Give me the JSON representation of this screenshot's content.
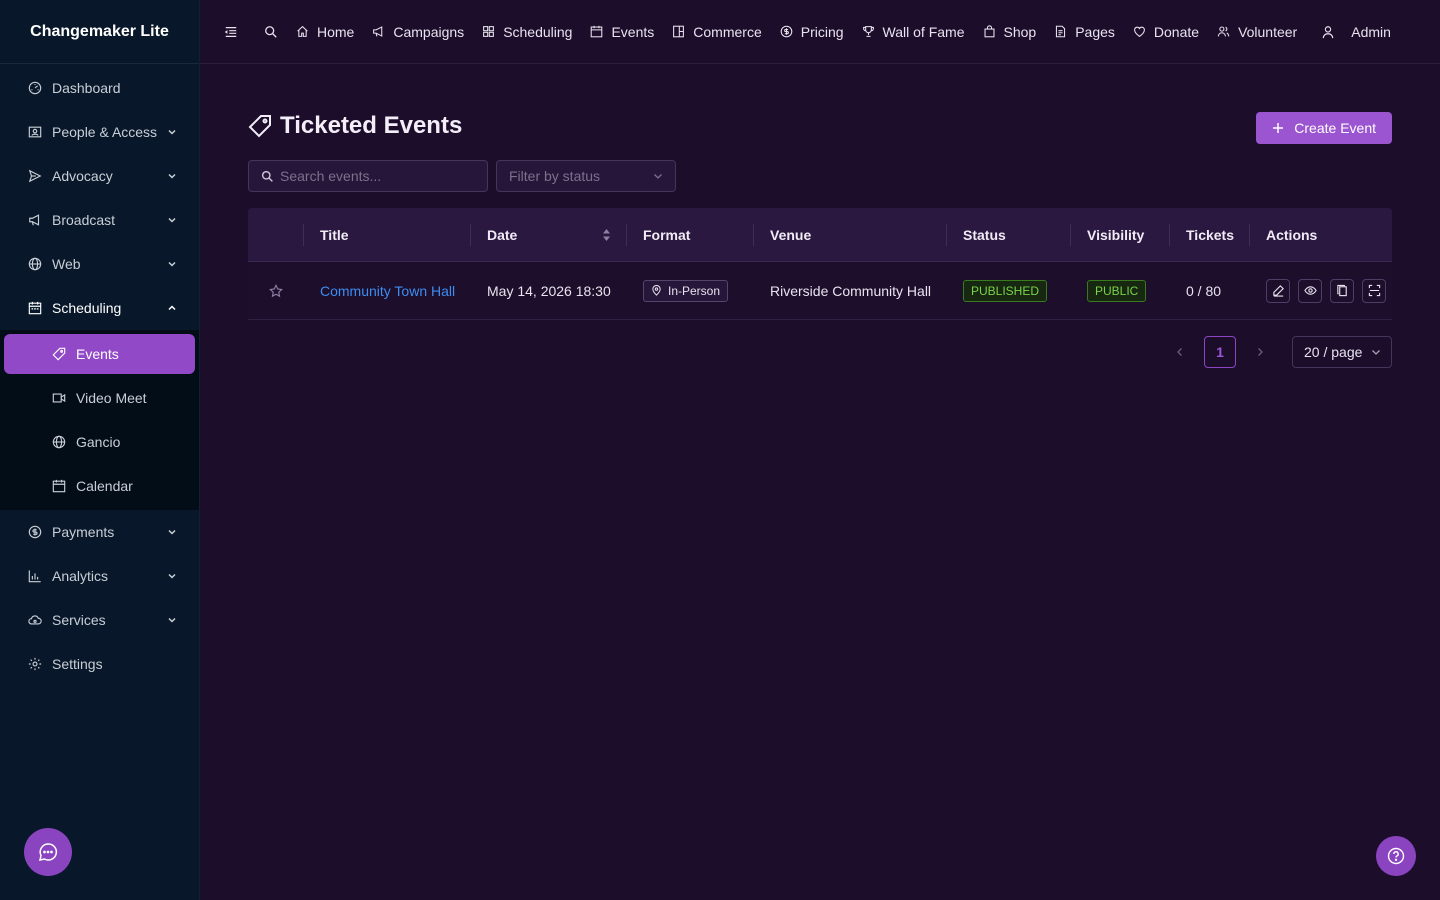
{
  "app": {
    "brand": "Changemaker Lite"
  },
  "sidebar": {
    "items": [
      {
        "label": "Dashboard",
        "icon": "dashboard-icon"
      },
      {
        "label": "People & Access",
        "icon": "contacts-icon"
      },
      {
        "label": "Advocacy",
        "icon": "send-icon"
      },
      {
        "label": "Broadcast",
        "icon": "megaphone-icon"
      },
      {
        "label": "Web",
        "icon": "globe-icon"
      },
      {
        "label": "Scheduling",
        "icon": "calendar-icon"
      },
      {
        "label": "Payments",
        "icon": "dollar-icon"
      },
      {
        "label": "Analytics",
        "icon": "bar-chart-icon"
      },
      {
        "label": "Services",
        "icon": "cloud-icon"
      },
      {
        "label": "Settings",
        "icon": "gear-icon"
      }
    ],
    "scheduling_sub": [
      {
        "label": "Events",
        "icon": "tag-icon",
        "active": true
      },
      {
        "label": "Video Meet",
        "icon": "video-icon"
      },
      {
        "label": "Gancio",
        "icon": "globe-icon"
      },
      {
        "label": "Calendar",
        "icon": "calendar-icon"
      }
    ]
  },
  "topnav": {
    "links": [
      {
        "label": "Home",
        "icon": "home-icon"
      },
      {
        "label": "Campaigns",
        "icon": "megaphone-icon"
      },
      {
        "label": "Scheduling",
        "icon": "grid-icon"
      },
      {
        "label": "Events",
        "icon": "calendar-icon"
      },
      {
        "label": "Commerce",
        "icon": "file-icon"
      },
      {
        "label": "Pricing",
        "icon": "dollar-icon"
      },
      {
        "label": "Wall of Fame",
        "icon": "trophy-icon"
      },
      {
        "label": "Shop",
        "icon": "bag-icon"
      },
      {
        "label": "Pages",
        "icon": "document-icon"
      },
      {
        "label": "Donate",
        "icon": "heart-icon"
      },
      {
        "label": "Volunteer",
        "icon": "users-icon"
      }
    ],
    "user": "Admin"
  },
  "page": {
    "title": "Ticketed Events",
    "create_label": "Create Event",
    "search_placeholder": "Search events...",
    "filter_placeholder": "Filter by status"
  },
  "table": {
    "columns": [
      "",
      "Title",
      "Date",
      "Format",
      "Venue",
      "Status",
      "Visibility",
      "Tickets",
      "Actions"
    ],
    "rows": [
      {
        "title": "Community Town Hall",
        "date": "May 14, 2026 18:30",
        "format": "In-Person",
        "venue": "Riverside Community Hall",
        "status": "PUBLISHED",
        "visibility": "PUBLIC",
        "tickets": "0 / 80"
      }
    ]
  },
  "pagination": {
    "current": "1",
    "page_size": "20 / page"
  },
  "colors": {
    "accent": "#9b55d0",
    "sidebar_bg": "#08182a",
    "main_bg": "#1c0d2b",
    "link": "#3d8cf0",
    "success": "#7bd24b"
  }
}
